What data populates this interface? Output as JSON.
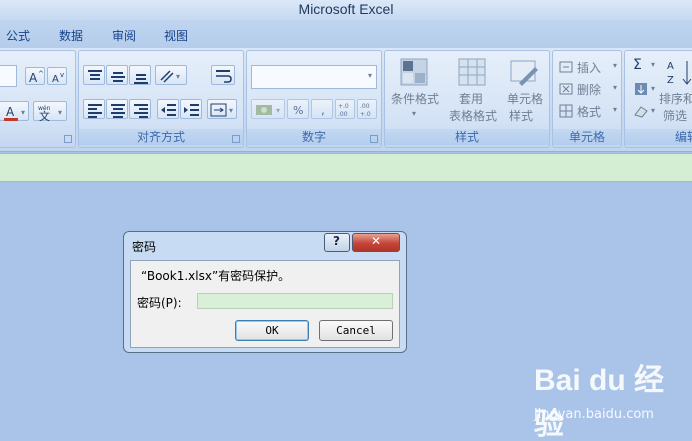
{
  "window": {
    "title": "Microsoft Excel"
  },
  "tabs": [
    {
      "label": "公式"
    },
    {
      "label": "数据"
    },
    {
      "label": "审阅"
    },
    {
      "label": "视图"
    }
  ],
  "ribbon": {
    "groups": {
      "alignment": {
        "label": "对齐方式"
      },
      "number": {
        "label": "数字",
        "percent": "%",
        "comma": ",",
        "inc_decimal": "+.0\n.00",
        "dec_decimal": ".00\n+.0"
      },
      "styles": {
        "label": "样式",
        "conditional_format": "条件格式",
        "table_format_line1": "套用",
        "table_format_line2": "表格格式",
        "cell_styles_line1": "单元格",
        "cell_styles_line2": "样式"
      },
      "cells": {
        "label": "单元格",
        "insert": "插入",
        "delete": "删除",
        "format": "格式"
      },
      "editing": {
        "label": "编辑",
        "sort_line1": "排序和",
        "sort_line2": "筛选",
        "sum_symbol": "Σ"
      }
    }
  },
  "dialog": {
    "title": "密码",
    "help_symbol": "?",
    "close_symbol": "✕",
    "message": "“Book1.xlsx”有密码保护。",
    "password_label": "密码(P):",
    "password_value": "",
    "ok_label": "OK",
    "cancel_label": "Cancel"
  },
  "watermark": {
    "logo": "Bai du 经验",
    "site": "jingyan.baidu.com"
  },
  "colors": {
    "background": "#a9c4e8",
    "ribbon": "#d3e2f5",
    "group_label": "#3e6aaa",
    "formula_bar": "#d3eed3",
    "close_button": "#c4463a",
    "password_field": "#d8efd8"
  },
  "icons": [
    "font-grow-icon",
    "font-shrink-icon",
    "font-color-icon",
    "phonetic-icon",
    "align-top-icon",
    "align-middle-icon",
    "align-bottom-icon",
    "orientation-icon",
    "wrap-text-icon",
    "align-left-icon",
    "align-center-icon",
    "align-right-icon",
    "decrease-indent-icon",
    "increase-indent-icon",
    "merge-cells-icon",
    "currency-icon",
    "conditional-format-icon",
    "table-format-icon",
    "cell-styles-icon",
    "insert-icon",
    "delete-icon",
    "format-icon",
    "autosum-icon",
    "fill-icon",
    "clear-icon",
    "sort-icon",
    "help-icon",
    "close-icon"
  ]
}
